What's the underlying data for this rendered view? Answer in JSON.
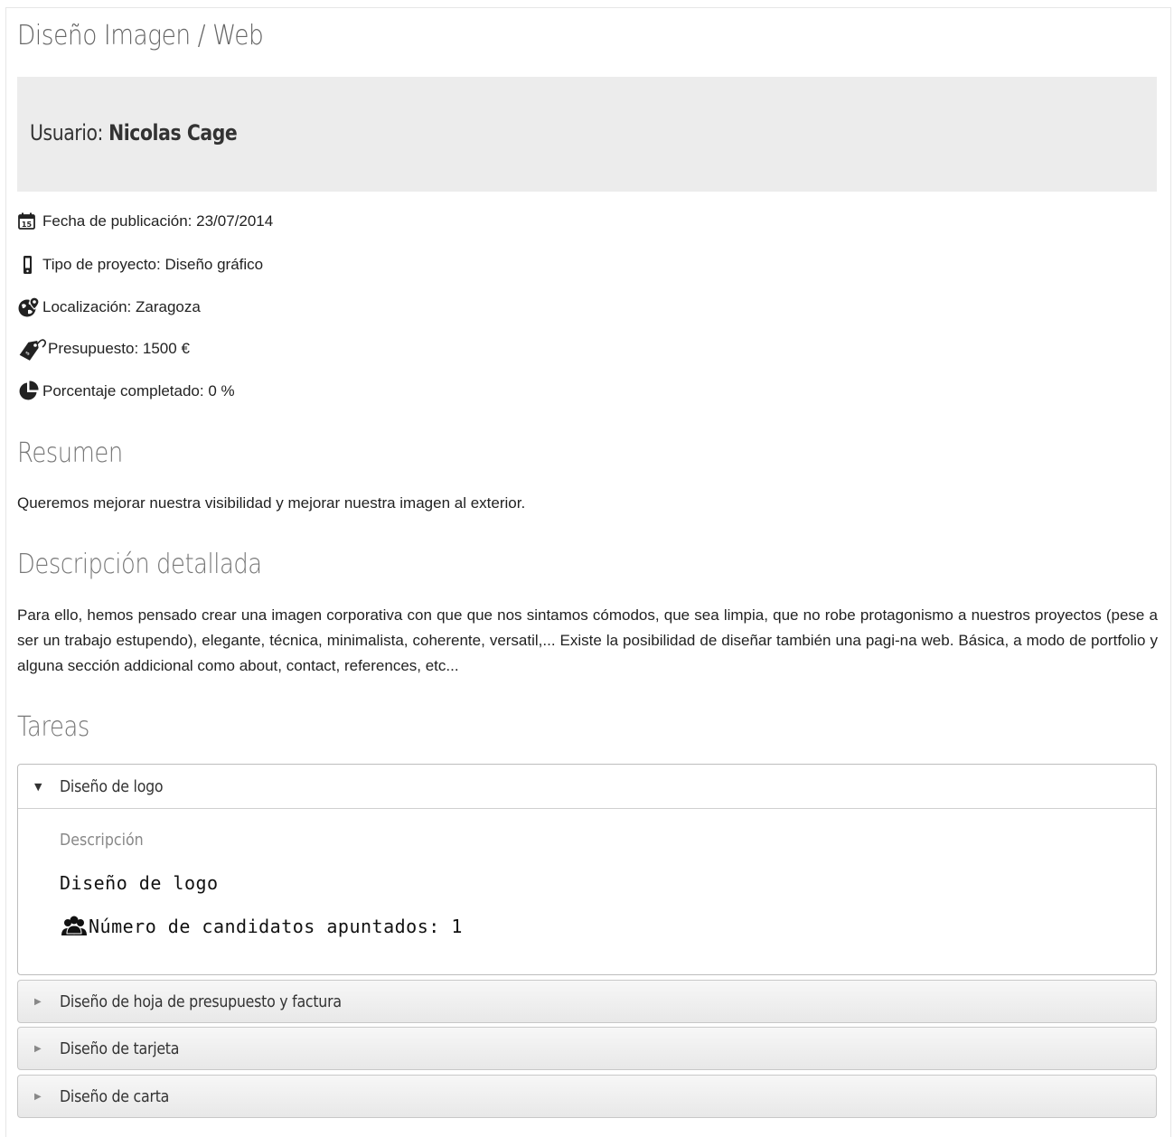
{
  "page": {
    "title": "Diseño Imagen / Web"
  },
  "user": {
    "label": "Usuario:",
    "name": "Nicolas Cage"
  },
  "meta": [
    {
      "icon": "calendar-icon",
      "text": "Fecha de publicación: 23/07/2014"
    },
    {
      "icon": "mobile-icon",
      "text": "Tipo de proyecto: Diseño gráfico"
    },
    {
      "icon": "globe-pin-icon",
      "text": "Localización: Zaragoza"
    },
    {
      "icon": "price-tag-icon",
      "text": "Presupuesto: 1500 €"
    },
    {
      "icon": "pie-chart-icon",
      "text": "Porcentaje completado: 0 %"
    }
  ],
  "summary": {
    "heading": "Resumen",
    "text": "Queremos mejorar nuestra visibilidad y mejorar nuestra imagen al exterior."
  },
  "details": {
    "heading": "Descripción detallada",
    "text": "Para ello, hemos pensado crear una imagen corporativa con que que nos sintamos cómodos, que sea limpia, que no robe protagonismo a nuestros proyectos (pese a ser un trabajo estupendo), elegante, técnica, minimalista, coherente, versatil,... Existe la posibilidad de diseñar también una pagi-na web. Básica, a modo de portfolio y alguna sección addicional como about, contact, references, etc..."
  },
  "tasks": {
    "heading": "Tareas",
    "items": [
      {
        "title": "Diseño de logo",
        "expanded": true,
        "description_label": "Descripción",
        "description": "Diseño de logo",
        "candidates_text": "Número de candidatos apuntados: 1"
      },
      {
        "title": "Diseño de hoja de presupuesto y factura",
        "expanded": false
      },
      {
        "title": "Diseño de tarjeta",
        "expanded": false
      },
      {
        "title": "Diseño de carta",
        "expanded": false
      }
    ]
  },
  "colors": {
    "user_box_bg": "#ececec",
    "heading": "#777777",
    "text": "#222222"
  }
}
